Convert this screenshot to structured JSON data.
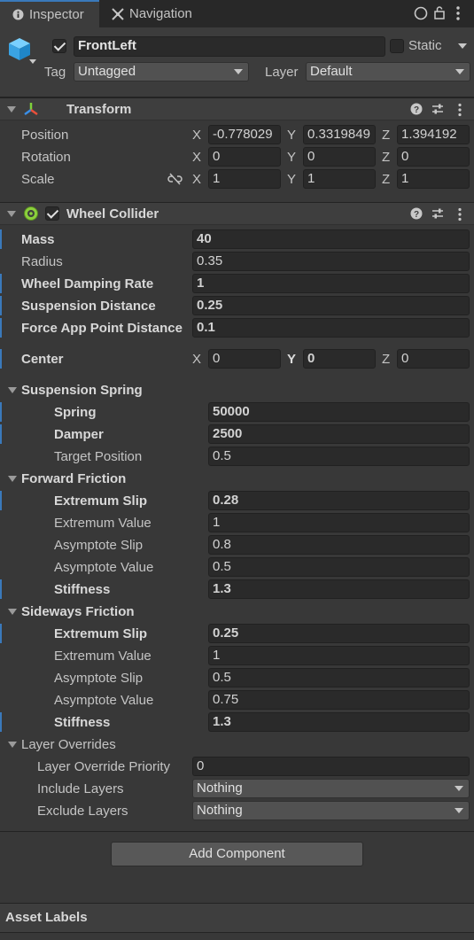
{
  "tabs": {
    "inspector": "Inspector",
    "navigation": "Navigation"
  },
  "header": {
    "object_name": "FrontLeft",
    "static_label": "Static",
    "tag_label": "Tag",
    "tag_value": "Untagged",
    "layer_label": "Layer",
    "layer_value": "Default"
  },
  "transform": {
    "title": "Transform",
    "rows": [
      {
        "label": "Position",
        "x": "-0.778029",
        "y": "0.3319849",
        "z": "1.394192"
      },
      {
        "label": "Rotation",
        "x": "0",
        "y": "0",
        "z": "0"
      },
      {
        "label": "Scale",
        "x": "1",
        "y": "1",
        "z": "1"
      }
    ]
  },
  "axes": {
    "x": "X",
    "y": "Y",
    "z": "Z"
  },
  "wheel_collider": {
    "title": "Wheel Collider",
    "mass_label": "Mass",
    "mass": "40",
    "radius_label": "Radius",
    "radius": "0.35",
    "damping_label": "Wheel Damping Rate",
    "damping": "1",
    "susp_dist_label": "Suspension Distance",
    "susp_dist": "0.25",
    "force_app_label": "Force App Point Distance",
    "force_app": "0.1",
    "center_label": "Center",
    "center_x": "0",
    "center_y": "0",
    "center_z": "0",
    "suspension_spring": {
      "title": "Suspension Spring",
      "spring_label": "Spring",
      "spring": "50000",
      "damper_label": "Damper",
      "damper": "2500",
      "target_label": "Target Position",
      "target": "0.5"
    },
    "forward_friction": {
      "title": "Forward Friction",
      "ext_slip_label": "Extremum Slip",
      "ext_slip": "0.28",
      "ext_value_label": "Extremum Value",
      "ext_value": "1",
      "asym_slip_label": "Asymptote Slip",
      "asym_slip": "0.8",
      "asym_value_label": "Asymptote Value",
      "asym_value": "0.5",
      "stiffness_label": "Stiffness",
      "stiffness": "1.3"
    },
    "sideways_friction": {
      "title": "Sideways Friction",
      "ext_slip_label": "Extremum Slip",
      "ext_slip": "0.25",
      "ext_value_label": "Extremum Value",
      "ext_value": "1",
      "asym_slip_label": "Asymptote Slip",
      "asym_slip": "0.5",
      "asym_value_label": "Asymptote Value",
      "asym_value": "0.75",
      "stiffness_label": "Stiffness",
      "stiffness": "1.3"
    },
    "layer_overrides": {
      "title": "Layer Overrides",
      "priority_label": "Layer Override Priority",
      "priority": "0",
      "include_label": "Include Layers",
      "include": "Nothing",
      "exclude_label": "Exclude Layers",
      "exclude": "Nothing"
    }
  },
  "add_component": "Add Component",
  "asset_labels": "Asset Labels",
  "colors": {
    "accent": "#3a79bb",
    "background": "#383838",
    "field": "#2a2a2a"
  }
}
